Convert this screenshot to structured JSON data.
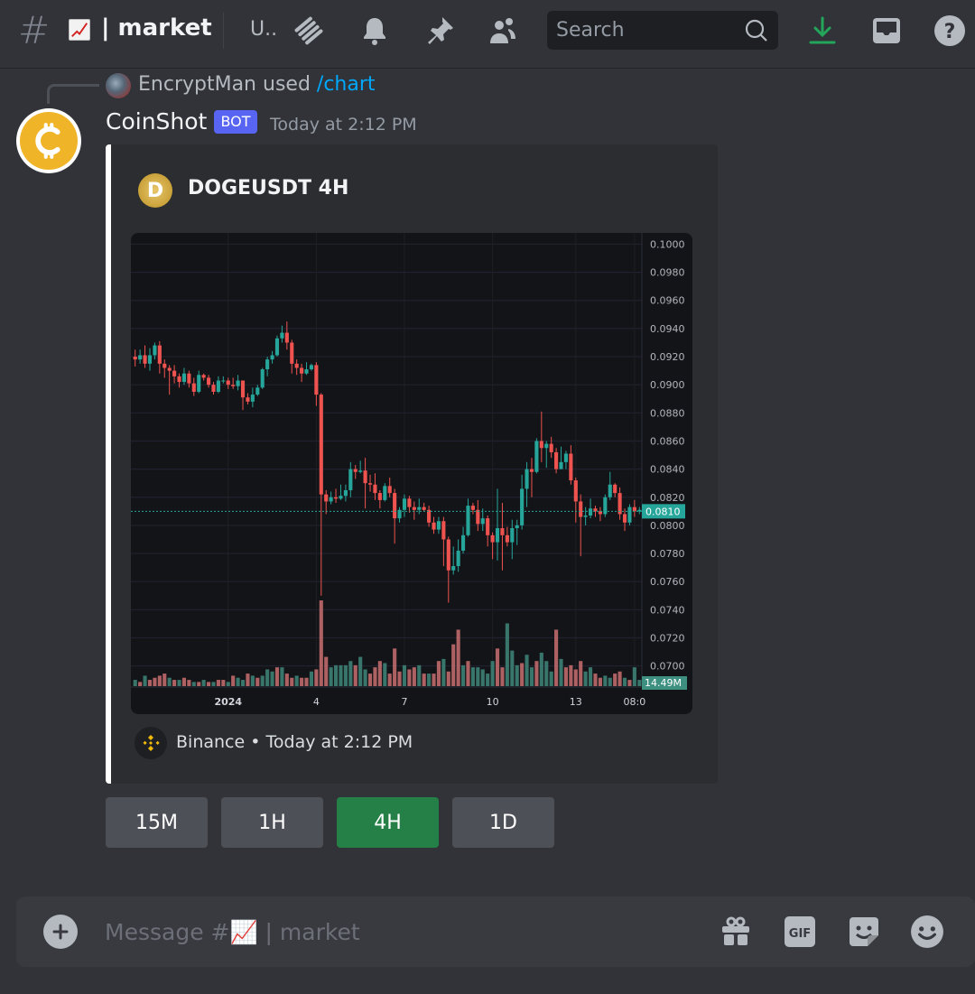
{
  "header": {
    "channel_prefix": "#",
    "channel_emoji": "chart-increasing",
    "channel_name": "| market",
    "topic_truncated": "U..",
    "search_placeholder": "Search",
    "icons": [
      "threads-icon",
      "bell-icon",
      "pin-icon",
      "members-icon",
      "download-icon",
      "inbox-icon",
      "help-icon"
    ]
  },
  "colors": {
    "bg": "#313338",
    "embed_bg": "#2b2d31",
    "accent_blurple": "#5865f2",
    "link": "#00a8fc",
    "download_green": "#23a55a",
    "active_button": "#248046",
    "candle_up": "#26a69a",
    "candle_down": "#ef5350",
    "avatar_gold": "#f0b429",
    "binance_gold": "#f0b90b"
  },
  "reply": {
    "user": "EncryptMan",
    "action": "used",
    "command": "/chart"
  },
  "message": {
    "author": "CoinShot",
    "badge": "BOT",
    "timestamp": "Today at 2:12 PM",
    "embed": {
      "title": "DOGEUSDT 4H",
      "footer_source": "Binance",
      "footer_separator": "•",
      "footer_time": "Today at 2:12 PM"
    }
  },
  "buttons": [
    {
      "label": "15M",
      "active": false
    },
    {
      "label": "1H",
      "active": false
    },
    {
      "label": "4H",
      "active": true
    },
    {
      "label": "1D",
      "active": false
    }
  ],
  "composer": {
    "placeholder": "Message #📈 | market",
    "icons": [
      "gift-icon",
      "gif-icon",
      "sticker-icon",
      "emoji-icon"
    ],
    "gif_label": "GIF"
  },
  "chart_data": {
    "type": "candlestick",
    "title": "DOGEUSDT 4H",
    "symbol": "DOGEUSDT",
    "interval": "4H",
    "ylim": [
      0.0685,
      0.1008
    ],
    "yticks": [
      "0.1000",
      "0.0980",
      "0.0960",
      "0.0940",
      "0.0920",
      "0.0900",
      "0.0880",
      "0.0860",
      "0.0840",
      "0.0820",
      "0.0800",
      "0.0780",
      "0.0760",
      "0.0740",
      "0.0720",
      "0.0700"
    ],
    "xticks": [
      {
        "label": "2024",
        "index": 19
      },
      {
        "label": "4",
        "index": 37
      },
      {
        "label": "7",
        "index": 55
      },
      {
        "label": "10",
        "index": 73
      },
      {
        "label": "13",
        "index": 90
      },
      {
        "label": "08:0",
        "index": 102
      }
    ],
    "last_price_label": "0.0810",
    "last_price": 0.081,
    "volume_label": "14.49M",
    "grid": true,
    "candles": [
      [
        0.092,
        0.0918,
        0.0925,
        0.0913
      ],
      [
        0.0918,
        0.0921,
        0.0925,
        0.0915
      ],
      [
        0.0921,
        0.0915,
        0.0928,
        0.0912
      ],
      [
        0.0915,
        0.0921,
        0.0926,
        0.091
      ],
      [
        0.0921,
        0.0928,
        0.093,
        0.0918
      ],
      [
        0.0928,
        0.0915,
        0.0931,
        0.0908
      ],
      [
        0.0915,
        0.0912,
        0.0918,
        0.0905
      ],
      [
        0.0912,
        0.091,
        0.0914,
        0.0893
      ],
      [
        0.091,
        0.0906,
        0.0914,
        0.0901
      ],
      [
        0.0906,
        0.0902,
        0.0908,
        0.0898
      ],
      [
        0.0902,
        0.0908,
        0.0912,
        0.09
      ],
      [
        0.0908,
        0.0901,
        0.091,
        0.0898
      ],
      [
        0.0901,
        0.0895,
        0.0905,
        0.0892
      ],
      [
        0.0895,
        0.0907,
        0.091,
        0.0894
      ],
      [
        0.0907,
        0.0905,
        0.0908,
        0.0903
      ],
      [
        0.0905,
        0.09,
        0.0907,
        0.0898
      ],
      [
        0.09,
        0.0895,
        0.0902,
        0.0893
      ],
      [
        0.0895,
        0.0903,
        0.0906,
        0.0894
      ],
      [
        0.0903,
        0.0903,
        0.0906,
        0.0901
      ],
      [
        0.0903,
        0.09,
        0.0905,
        0.0897
      ],
      [
        0.09,
        0.0899,
        0.0905,
        0.0897
      ],
      [
        0.0899,
        0.0903,
        0.0907,
        0.0896
      ],
      [
        0.0903,
        0.0891,
        0.0903,
        0.0882
      ],
      [
        0.0891,
        0.0888,
        0.0894,
        0.0886
      ],
      [
        0.0888,
        0.0893,
        0.0898,
        0.0884
      ],
      [
        0.0893,
        0.0898,
        0.09,
        0.0892
      ],
      [
        0.0898,
        0.0911,
        0.0912,
        0.0897
      ],
      [
        0.0911,
        0.0918,
        0.092,
        0.0906
      ],
      [
        0.0918,
        0.0921,
        0.0924,
        0.0915
      ],
      [
        0.0921,
        0.0933,
        0.0935,
        0.092
      ],
      [
        0.0933,
        0.0937,
        0.0942,
        0.093
      ],
      [
        0.0937,
        0.093,
        0.0945,
        0.0925
      ],
      [
        0.093,
        0.0915,
        0.0932,
        0.0908
      ],
      [
        0.0915,
        0.0912,
        0.0918,
        0.0907
      ],
      [
        0.0912,
        0.0908,
        0.0915,
        0.0902
      ],
      [
        0.0908,
        0.0911,
        0.0916,
        0.0907
      ],
      [
        0.0911,
        0.0914,
        0.0915,
        0.091
      ],
      [
        0.0914,
        0.0893,
        0.0916,
        0.0885
      ],
      [
        0.0893,
        0.0822,
        0.0894,
        0.075
      ],
      [
        0.0822,
        0.0817,
        0.0825,
        0.0808
      ],
      [
        0.0817,
        0.082,
        0.0824,
        0.0815
      ],
      [
        0.082,
        0.0819,
        0.0826,
        0.0816
      ],
      [
        0.0819,
        0.0821,
        0.0829,
        0.0818
      ],
      [
        0.0821,
        0.0825,
        0.0829,
        0.0817
      ],
      [
        0.0825,
        0.084,
        0.0845,
        0.082
      ],
      [
        0.084,
        0.0838,
        0.0843,
        0.0833
      ],
      [
        0.0838,
        0.0839,
        0.0846,
        0.0837
      ],
      [
        0.0839,
        0.083,
        0.0848,
        0.0812
      ],
      [
        0.083,
        0.0829,
        0.0836,
        0.0824
      ],
      [
        0.0829,
        0.0823,
        0.0837,
        0.0818
      ],
      [
        0.0823,
        0.0818,
        0.0825,
        0.0812
      ],
      [
        0.0818,
        0.0828,
        0.083,
        0.0817
      ],
      [
        0.0828,
        0.0823,
        0.0834,
        0.082
      ],
      [
        0.0823,
        0.0805,
        0.0826,
        0.0787
      ],
      [
        0.0805,
        0.0811,
        0.0813,
        0.0802
      ],
      [
        0.0811,
        0.0819,
        0.0822,
        0.0806
      ],
      [
        0.0819,
        0.0813,
        0.0821,
        0.0809
      ],
      [
        0.0813,
        0.0811,
        0.0817,
        0.0804
      ],
      [
        0.0811,
        0.0813,
        0.0819,
        0.0808
      ],
      [
        0.0813,
        0.0811,
        0.0816,
        0.081
      ],
      [
        0.0811,
        0.0802,
        0.0814,
        0.0799
      ],
      [
        0.0802,
        0.0797,
        0.0806,
        0.0794
      ],
      [
        0.0797,
        0.0803,
        0.0806,
        0.0794
      ],
      [
        0.0803,
        0.079,
        0.0806,
        0.0771
      ],
      [
        0.079,
        0.0768,
        0.0792,
        0.0745
      ],
      [
        0.0768,
        0.0771,
        0.0785,
        0.0765
      ],
      [
        0.0771,
        0.0782,
        0.079,
        0.0767
      ],
      [
        0.0782,
        0.0793,
        0.0799,
        0.078
      ],
      [
        0.0793,
        0.0814,
        0.0819,
        0.0792
      ],
      [
        0.0814,
        0.0811,
        0.0816,
        0.0808
      ],
      [
        0.0811,
        0.0801,
        0.0818,
        0.0796
      ],
      [
        0.0801,
        0.0805,
        0.0812,
        0.0796
      ],
      [
        0.0805,
        0.0793,
        0.0807,
        0.0785
      ],
      [
        0.0793,
        0.0788,
        0.0795,
        0.0776
      ],
      [
        0.0788,
        0.0798,
        0.0826,
        0.0775
      ],
      [
        0.0798,
        0.0793,
        0.0816,
        0.0768
      ],
      [
        0.0793,
        0.0788,
        0.0799,
        0.0785
      ],
      [
        0.0788,
        0.0798,
        0.0804,
        0.0776
      ],
      [
        0.0798,
        0.08,
        0.0804,
        0.0786
      ],
      [
        0.08,
        0.0826,
        0.0836,
        0.0797
      ],
      [
        0.0826,
        0.084,
        0.0845,
        0.0813
      ],
      [
        0.084,
        0.0838,
        0.0848,
        0.082
      ],
      [
        0.0838,
        0.086,
        0.0862,
        0.0837
      ],
      [
        0.086,
        0.0855,
        0.0881,
        0.0845
      ],
      [
        0.0855,
        0.0858,
        0.086,
        0.0841
      ],
      [
        0.0858,
        0.0852,
        0.0863,
        0.0848
      ],
      [
        0.0852,
        0.084,
        0.0855,
        0.0837
      ],
      [
        0.084,
        0.0845,
        0.0856,
        0.0841
      ],
      [
        0.0845,
        0.0851,
        0.0853,
        0.084
      ],
      [
        0.0851,
        0.0832,
        0.0857,
        0.0829
      ],
      [
        0.0832,
        0.0817,
        0.0834,
        0.0802
      ],
      [
        0.0817,
        0.0806,
        0.0822,
        0.0778
      ],
      [
        0.0806,
        0.0807,
        0.0813,
        0.08
      ],
      [
        0.0807,
        0.0812,
        0.0819,
        0.0805
      ],
      [
        0.0812,
        0.081,
        0.0814,
        0.0806
      ],
      [
        0.081,
        0.0808,
        0.0813,
        0.0803
      ],
      [
        0.0808,
        0.082,
        0.0822,
        0.0806
      ],
      [
        0.082,
        0.0829,
        0.0838,
        0.0818
      ],
      [
        0.0829,
        0.0823,
        0.083,
        0.082
      ],
      [
        0.0823,
        0.0808,
        0.0827,
        0.0804
      ],
      [
        0.0808,
        0.0802,
        0.0812,
        0.0796
      ],
      [
        0.0802,
        0.0813,
        0.0815,
        0.08
      ],
      [
        0.0813,
        0.081,
        0.0818,
        0.0806
      ],
      [
        0.081,
        0.0811,
        0.0813,
        0.0808
      ]
    ],
    "volume": [
      3,
      2,
      5,
      3,
      4,
      5,
      6,
      4,
      3,
      3,
      4,
      3,
      2,
      2,
      3,
      2,
      2,
      3,
      3,
      2,
      5,
      4,
      3,
      6,
      5,
      4,
      5,
      8,
      7,
      9,
      9,
      6,
      4,
      5,
      4,
      4,
      7,
      8,
      41,
      14,
      9,
      10,
      10,
      10,
      12,
      10,
      14,
      8,
      6,
      9,
      12,
      11,
      6,
      18,
      7,
      10,
      8,
      9,
      10,
      6,
      6,
      6,
      12,
      13,
      7,
      20,
      27,
      10,
      12,
      9,
      9,
      8,
      6,
      12,
      18,
      9,
      30,
      17,
      10,
      11,
      15,
      9,
      12,
      16,
      12,
      7,
      27,
      13,
      9,
      10,
      8,
      12,
      7,
      9,
      6,
      4,
      5,
      4,
      6,
      7,
      4,
      3,
      9,
      3
    ],
    "volume_up": [
      true,
      false,
      true,
      false,
      false,
      false,
      false,
      true,
      false,
      true,
      false,
      false,
      true,
      false,
      true,
      false,
      true,
      false,
      false,
      true,
      false,
      true,
      true,
      false,
      true,
      false,
      true,
      true,
      true,
      false,
      true,
      false,
      false,
      true,
      false,
      false,
      true,
      false,
      false,
      false,
      true,
      true,
      true,
      true,
      true,
      false,
      true,
      true,
      false,
      false,
      false,
      true,
      false,
      false,
      false,
      true,
      false,
      false,
      true,
      false,
      true,
      false,
      false,
      true,
      false,
      false,
      false,
      true,
      false,
      true,
      true,
      true,
      true,
      true,
      false,
      false,
      true,
      true,
      true,
      false,
      true,
      true,
      false,
      true,
      true,
      true,
      false,
      true,
      false,
      false,
      false,
      false,
      true,
      true,
      false,
      false,
      true,
      true,
      false,
      false,
      true,
      false,
      true,
      true
    ]
  }
}
